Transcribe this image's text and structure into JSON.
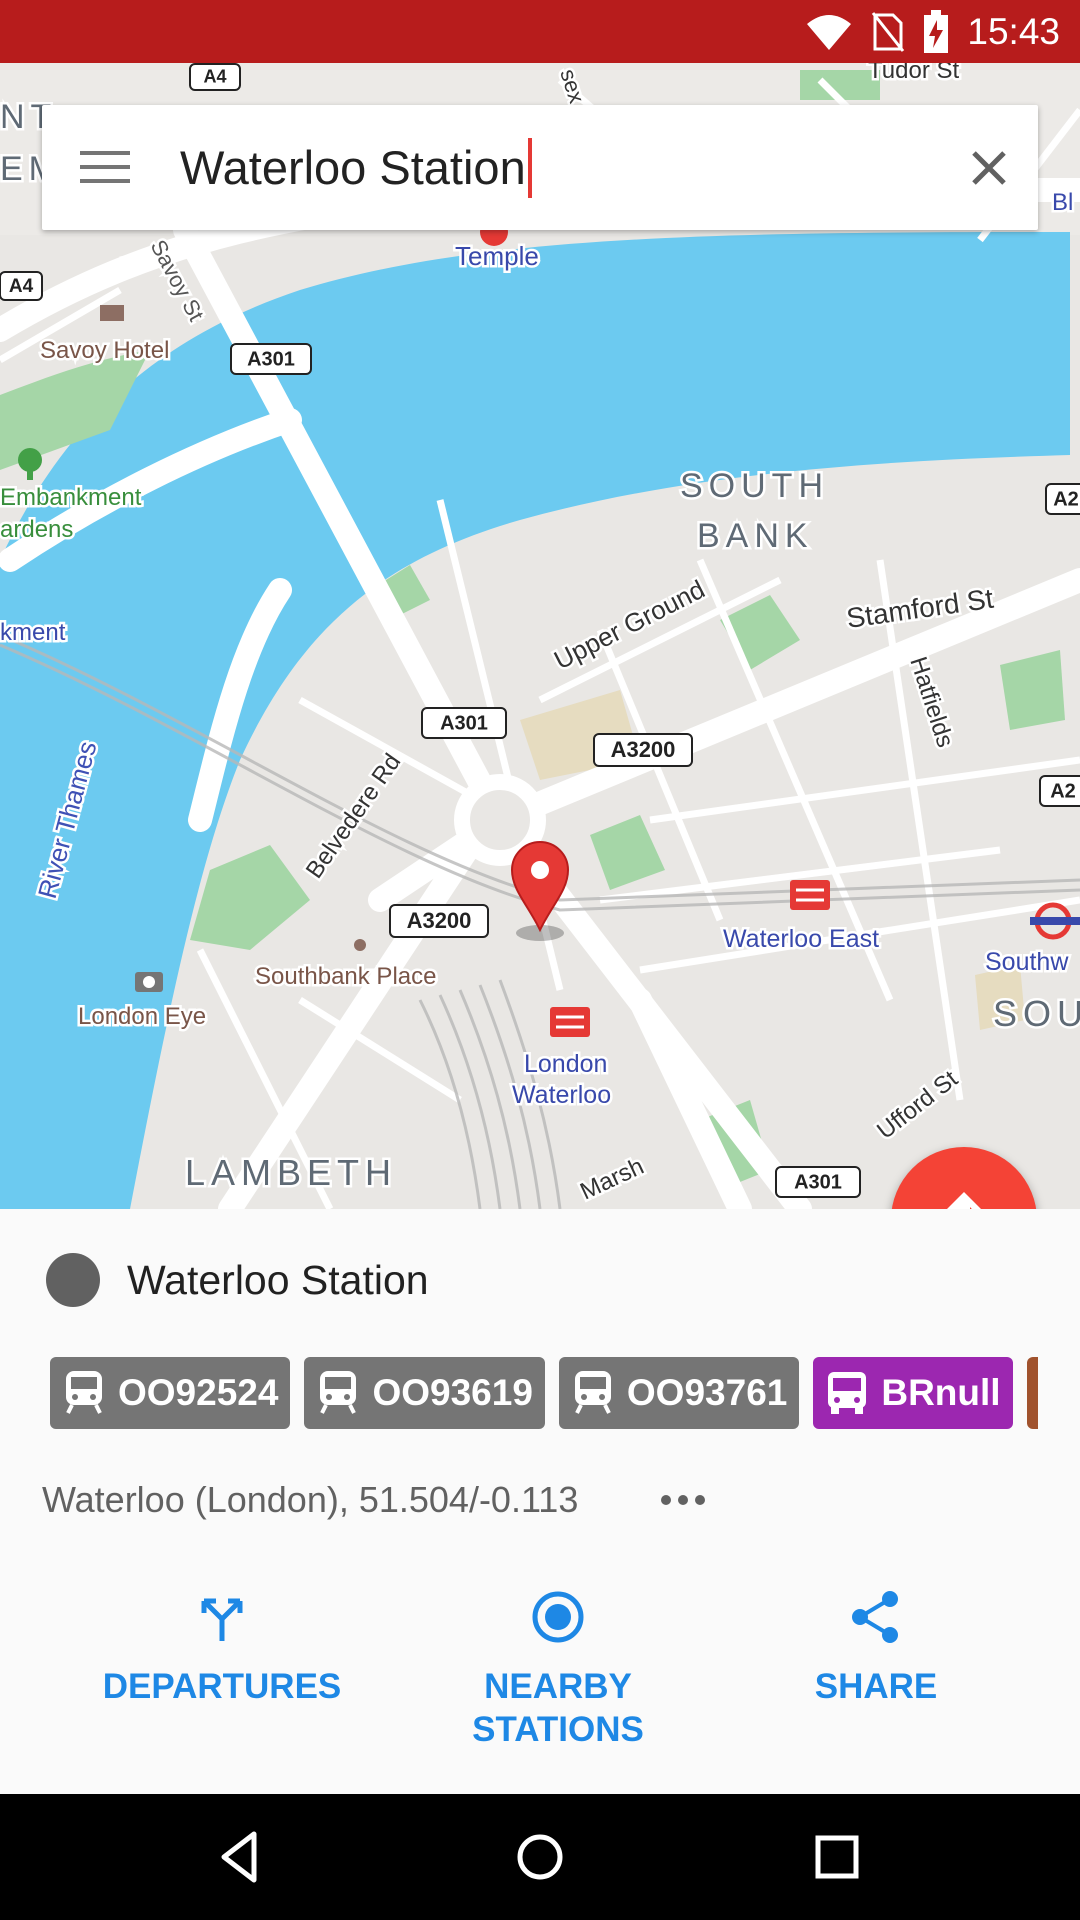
{
  "status_bar": {
    "time": "15:43"
  },
  "search": {
    "value": "Waterloo Station"
  },
  "map": {
    "labels": [
      {
        "name": "temple",
        "text": "Temple",
        "color": "#3949ab"
      },
      {
        "name": "savoy-hotel",
        "text": "Savoy Hotel",
        "color": "#795548"
      },
      {
        "name": "savoy-st",
        "text": "Savoy St",
        "color": "#555555"
      },
      {
        "name": "embankment-gardens-1",
        "text": "Embankment",
        "color": "#388e3c"
      },
      {
        "name": "embankment-gardens-2",
        "text": "ardens",
        "color": "#388e3c"
      },
      {
        "name": "embankment-station",
        "text": "kment",
        "color": "#3949ab"
      },
      {
        "name": "south-bank-1",
        "text": "SOUTH",
        "color": "#5f6a75"
      },
      {
        "name": "south-bank-2",
        "text": "BANK",
        "color": "#5f6a75"
      },
      {
        "name": "upper-ground",
        "text": "Upper Ground",
        "color": "#333333"
      },
      {
        "name": "stamford-st",
        "text": "Stamford St",
        "color": "#333333"
      },
      {
        "name": "hatfields",
        "text": "Hatfields",
        "color": "#333333"
      },
      {
        "name": "river-thames",
        "text": "River Thames",
        "color": "#3f51b5"
      },
      {
        "name": "belvedere-rd",
        "text": "Belvedere Rd",
        "color": "#333333"
      },
      {
        "name": "southbank-place",
        "text": "Southbank Place",
        "color": "#795548"
      },
      {
        "name": "london-eye",
        "text": "London Eye",
        "color": "#795548"
      },
      {
        "name": "waterloo-east",
        "text": "Waterloo East",
        "color": "#3949ab"
      },
      {
        "name": "southwark",
        "text": "Southw",
        "color": "#3949ab"
      },
      {
        "name": "sou",
        "text": "SOU",
        "color": "#5f6a75"
      },
      {
        "name": "london-waterloo-1",
        "text": "London",
        "color": "#3949ab"
      },
      {
        "name": "london-waterloo-2",
        "text": "Waterloo",
        "color": "#3949ab"
      },
      {
        "name": "lambeth",
        "text": "LAMBETH",
        "color": "#5f6a75"
      },
      {
        "name": "ufford-st",
        "text": "Ufford St",
        "color": "#333333"
      },
      {
        "name": "marsh",
        "text": "Marsh",
        "color": "#333333"
      },
      {
        "name": "tudor-st",
        "text": "Tudor St",
        "color": "#333333"
      },
      {
        "name": "essex-st",
        "text": "sex S",
        "color": "#333333"
      },
      {
        "name": "edge-nt",
        "text": "NT",
        "color": "#5f6a75"
      },
      {
        "name": "edge-em",
        "text": "EM",
        "color": "#5f6a75"
      },
      {
        "name": "edge-bl",
        "text": "Bl",
        "color": "#3949ab"
      }
    ],
    "road_shields": [
      {
        "name": "a4-top",
        "text": "A4"
      },
      {
        "name": "a4-left",
        "text": "A4"
      },
      {
        "name": "a301-north",
        "text": "A301"
      },
      {
        "name": "a301-mid",
        "text": "A301"
      },
      {
        "name": "a3200-east",
        "text": "A3200"
      },
      {
        "name": "a3200-west",
        "text": "A3200"
      },
      {
        "name": "a301-south",
        "text": "A301"
      },
      {
        "name": "a2-right-1",
        "text": "A2"
      },
      {
        "name": "a2-right-2",
        "text": "A2"
      }
    ]
  },
  "station": {
    "name": "Waterloo Station",
    "location": "Waterloo (London), 51.504/-0.113",
    "lines": [
      {
        "label": "OO92524",
        "color": "#757575",
        "icon": "train-icon"
      },
      {
        "label": "OO93619",
        "color": "#757575",
        "icon": "train-icon"
      },
      {
        "label": "OO93761",
        "color": "#757575",
        "icon": "train-icon"
      },
      {
        "label": "BRnull",
        "color": "#9c27b0",
        "icon": "bus-icon"
      },
      {
        "label": "",
        "color": "#a0522d",
        "icon": "tram-icon"
      }
    ]
  },
  "actions": [
    {
      "label": "DEPARTURES",
      "icon": "departures-icon"
    },
    {
      "label": "NEARBY\nSTATIONS",
      "icon": "nearby-icon"
    },
    {
      "label": "SHARE",
      "icon": "share-icon"
    }
  ],
  "colors": {
    "accent": "#1e88e5",
    "fab": "#f44336",
    "status_bar": "#b71c1c",
    "water": "#6ccaf0"
  }
}
